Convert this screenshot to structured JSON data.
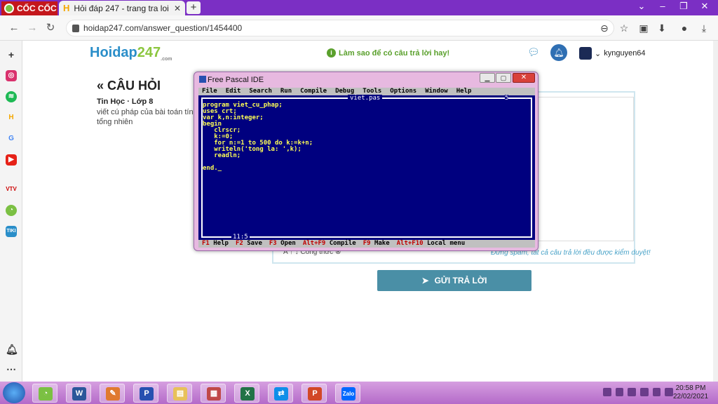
{
  "browser": {
    "brand": "CỐC CỐC",
    "tab_title": "Hỏi đáp 247 - trang tra loi",
    "tab_favicon": "H",
    "url": "hoidap247.com/answer_question/1454400"
  },
  "site": {
    "logo_main": "Hoidap",
    "logo_num": "247",
    "logo_sub": ".com",
    "hint": "Làm sao để có câu trả lời hay!",
    "username": "kynguyen64"
  },
  "question": {
    "header": "CÂU HỎI",
    "back_glyph": "«",
    "subject": "Tin Học · Lớp 8",
    "text": "viết cú pháp của bài toán tính tổng nhiên"
  },
  "answer": {
    "note": "Đừng spam, tất cả câu trả lời đều được kiểm duyệt!",
    "tools": "A  ↑  ↓    Công thức  ⊗",
    "submit_label": "GỬI TRẢ LỜI"
  },
  "fpc": {
    "window_title": "Free Pascal IDE",
    "menu": [
      "File",
      "Edit",
      "Search",
      "Run",
      "Compile",
      "Debug",
      "Tools",
      "Options",
      "Window",
      "Help"
    ],
    "filename": "viet.pas",
    "window_number": "5",
    "code": "program viet_cu_phap;\nuses crt;\nvar k,n:integer;\nbegin\n   clrscr;\n   k:=0;\n   for n:=1 to 500 do k:=k+n;\n   writeln('tong la: ',k);\n   readln;\n\nend._",
    "cursor_pos": "11:5",
    "status_items": [
      {
        "key": "F1",
        "label": "Help"
      },
      {
        "key": "F2",
        "label": "Save"
      },
      {
        "key": "F3",
        "label": "Open"
      },
      {
        "key": "Alt+F9",
        "label": "Compile"
      },
      {
        "key": "F9",
        "label": "Make"
      },
      {
        "key": "Alt+F10",
        "label": "Local menu"
      }
    ]
  },
  "taskbar": {
    "time": "20:58 PM",
    "date": "22/02/2021"
  },
  "colors": {
    "tab_strip": "#7b2fc4",
    "pascal_bg": "#00007f",
    "submit_bg": "#4a8fa6"
  }
}
